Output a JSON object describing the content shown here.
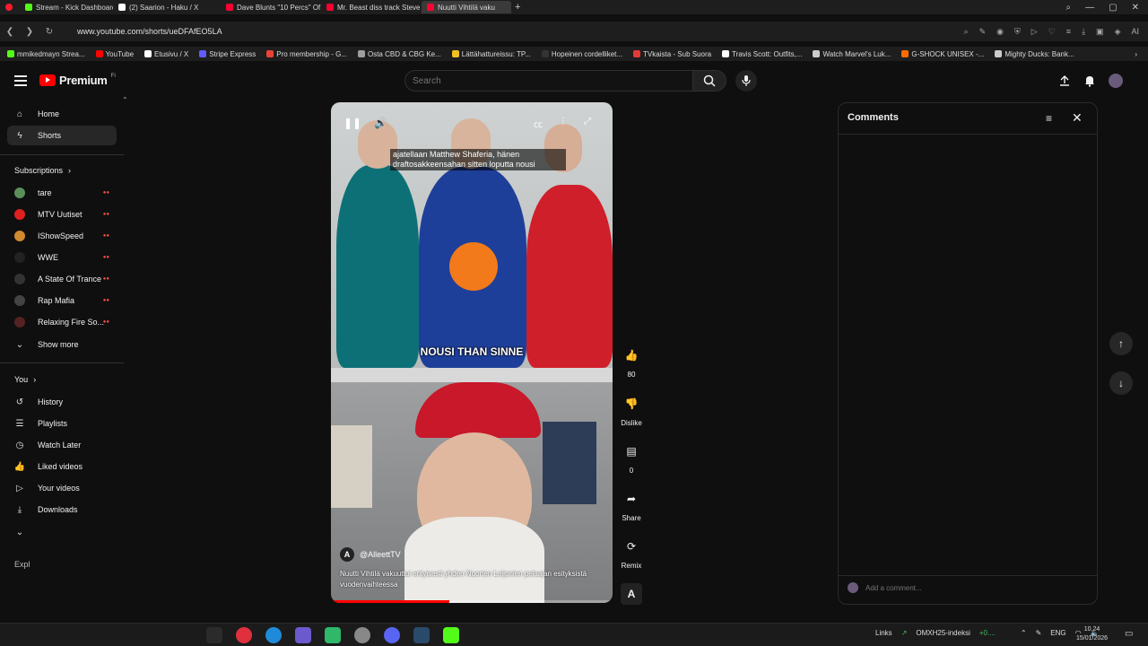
{
  "browser": {
    "tabs": [
      {
        "label": "Stream - Kick Dashboard",
        "color": "#53fc18",
        "active": false
      },
      {
        "label": "(2) Saarion - Haku / X",
        "color": "#ffffff",
        "active": false
      },
      {
        "label": "Dave Blunts \"10 Percs\" Of",
        "color": "#ff0033",
        "active": false
      },
      {
        "label": "Mr. Beast diss track Steve",
        "color": "#ff0033",
        "active": false
      },
      {
        "label": "Nuutti Vihtilä vaku",
        "color": "#ff0033",
        "active": true
      }
    ],
    "url": "www.youtube.com/shorts/ueDFAfEO5LA",
    "bookmarks": [
      {
        "label": "mmikedmayn Strea...",
        "color": "#53fc18"
      },
      {
        "label": "YouTube",
        "color": "#ff0000"
      },
      {
        "label": "Etusivu / X",
        "color": "#ffffff"
      },
      {
        "label": "Stripe Express",
        "color": "#635bff"
      },
      {
        "label": "Pro membership - G...",
        "color": "#ea4335"
      },
      {
        "label": "Osta CBD & CBG Ke...",
        "color": "#9e9e9e"
      },
      {
        "label": "Lättähattureissu: TP...",
        "color": "#f0c020"
      },
      {
        "label": "Hopeinen cordelliket...",
        "color": "#333333"
      },
      {
        "label": "TVkaista - Sub Suora",
        "color": "#e53935"
      },
      {
        "label": "Travis Scott: Outfits,...",
        "color": "#ffffff"
      },
      {
        "label": "Watch Marvel's Luk...",
        "color": "#cccccc"
      },
      {
        "label": "G-SHOCK UNISEX -...",
        "color": "#ff6d00"
      },
      {
        "label": "Mighty Ducks: Bank...",
        "color": "#cccccc"
      }
    ]
  },
  "header": {
    "logo_text": "Premium",
    "logo_region": "FI",
    "search_placeholder": "Search"
  },
  "sidebar": {
    "main": [
      {
        "label": "Home",
        "icon": "home-icon"
      },
      {
        "label": "Shorts",
        "icon": "shorts-icon"
      }
    ],
    "subscriptions_title": "Subscriptions",
    "subscriptions": [
      {
        "label": "tare",
        "color": "#5a8f5a"
      },
      {
        "label": "MTV Uutiset",
        "color": "#e02020"
      },
      {
        "label": "IShowSpeed",
        "color": "#d08a30"
      },
      {
        "label": "WWE",
        "color": "#222222"
      },
      {
        "label": "A State Of Trance",
        "color": "#333333"
      },
      {
        "label": "Rap Mafia",
        "color": "#444444"
      },
      {
        "label": "Relaxing Fire So...",
        "color": "#552222"
      }
    ],
    "show_more": "Show more",
    "you_title": "You",
    "you_items": [
      {
        "label": "History",
        "icon": "history-icon"
      },
      {
        "label": "Playlists",
        "icon": "playlists-icon"
      },
      {
        "label": "Watch Later",
        "icon": "watch-later-icon"
      },
      {
        "label": "Liked videos",
        "icon": "liked-videos-icon"
      },
      {
        "label": "Your videos",
        "icon": "your-videos-icon"
      },
      {
        "label": "Downloads",
        "icon": "downloads-icon"
      }
    ],
    "explore_title": "Expl"
  },
  "player": {
    "caption_top": "ajatellaan Matthew Shaferia, hänen draftosakkeensahan sitten loputta nousi",
    "caption_mid": "NOUSI THAN SINNE",
    "channel": "@AlleettTV",
    "description": "Nuutti Vihtilä vakuuttui erityisesti yhden Nuorten Leijonien pelaajan esityksistä vuodenvaihteessa",
    "progress_fraction": 0.42
  },
  "actions": {
    "likes": "80",
    "dislike_label": "Dislike",
    "comments_count": "0",
    "share_label": "Share",
    "remix_label": "Remix"
  },
  "comments": {
    "title": "Comments",
    "add_placeholder": "Add a comment..."
  },
  "taskbar": {
    "links_label": "Links",
    "ticker": "OMXH25-indeksi",
    "ticker_change": "+0....",
    "lang": "ENG",
    "time": "10.24",
    "date": "15/01/2026"
  }
}
